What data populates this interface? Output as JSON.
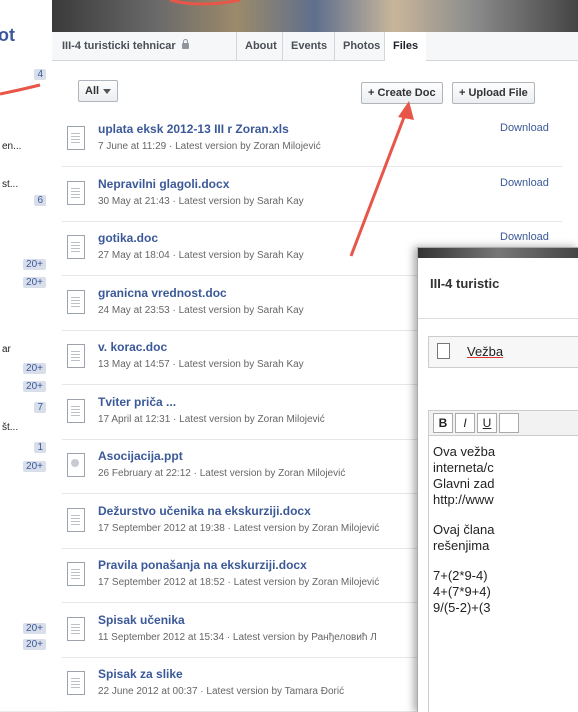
{
  "left_panel": {
    "title_fragment": "ot",
    "rows": [
      {
        "label": "",
        "count": "4"
      },
      {
        "label": "en...",
        "count": ""
      },
      {
        "label": "st...",
        "count": ""
      },
      {
        "label": "",
        "count": "6"
      },
      {
        "label": "",
        "count": "20+"
      },
      {
        "label": "",
        "count": "20+"
      },
      {
        "label": "ar",
        "count": ""
      },
      {
        "label": "",
        "count": "20+"
      },
      {
        "label": "",
        "count": "20+"
      },
      {
        "label": "",
        "count": "7"
      },
      {
        "label": "št...",
        "count": ""
      },
      {
        "label": "",
        "count": "1"
      },
      {
        "label": "",
        "count": "20+"
      },
      {
        "label": "",
        "count": "20+"
      },
      {
        "label": "",
        "count": "20+"
      }
    ]
  },
  "header": {
    "group_name": "III-4 turisticki tehnicar",
    "tabs": [
      "About",
      "Events",
      "Photos",
      "Files"
    ],
    "active_tab": "Files"
  },
  "toolbar": {
    "filter_label": "All",
    "create_doc_label": "+ Create Doc",
    "upload_file_label": "+ Upload File"
  },
  "files": [
    {
      "name": "uplata eksk 2012-13 III r Zoran.xls",
      "meta": "7 June at 11:29 · Latest version by Zoran Milojević",
      "action": "Download",
      "icon": "spreadsheet-icon"
    },
    {
      "name": "Nepravilni glagoli.docx",
      "meta": "30 May at 21:43 · Latest version by Sarah Kay",
      "action": "Download",
      "icon": "document-icon"
    },
    {
      "name": "gotika.doc",
      "meta": "27 May at 18:04 · Latest version by Sarah Kay",
      "action": "Download",
      "icon": "document-icon"
    },
    {
      "name": "granicna vrednost.doc",
      "meta": "24 May at 23:53 · Latest version by Sarah Kay",
      "action": "",
      "icon": "document-icon"
    },
    {
      "name": "v. korac.doc",
      "meta": "13 May at 14:57 · Latest version by Sarah Kay",
      "action": "",
      "icon": "document-icon"
    },
    {
      "name": "Tviter priča ...",
      "meta": "17 April at 12:31 · Latest version by Zoran Milojević",
      "action": "",
      "icon": "document-icon"
    },
    {
      "name": "Asocijacija.ppt",
      "meta": "26 February at 22:12 · Latest version by Zoran Milojević",
      "action": "",
      "icon": "presentation-icon"
    },
    {
      "name": "Dežurstvo učenika na ekskurziji.docx",
      "meta": "17 September 2012 at 19:38 · Latest version by Zoran Milojević",
      "action": "",
      "icon": "document-icon"
    },
    {
      "name": "Pravila ponašanja na ekskurziji.docx",
      "meta": "17 September 2012 at 18:52 · Latest version by Zoran Milojević",
      "action": "",
      "icon": "document-icon"
    },
    {
      "name": "Spisak učenika",
      "meta": "11 September 2012 at 15:34 · Latest version by Ранђеловић Л",
      "action": "",
      "icon": "document-icon"
    },
    {
      "name": "Spisak za slike",
      "meta": "22 June 2012 at 00:37 · Latest version by Tamara Đorić",
      "action": "",
      "icon": "document-icon"
    }
  ],
  "doc_window": {
    "title": "III-4 turistic",
    "name_value": "Vežba",
    "format_buttons": [
      "B",
      "I",
      "U"
    ],
    "body_lines_1": [
      "Ova vežba",
      "interneta/c",
      "Glavni zad",
      "http://www"
    ],
    "body_lines_2": [
      "Ovaj člana",
      "rešenjima"
    ],
    "body_lines_3": [
      "7+(2*9-4)",
      "4+(7*9+4)",
      "9/(5-2)+(3"
    ]
  },
  "colors": {
    "link": "#3b5998",
    "arrow": "#e8564a"
  }
}
